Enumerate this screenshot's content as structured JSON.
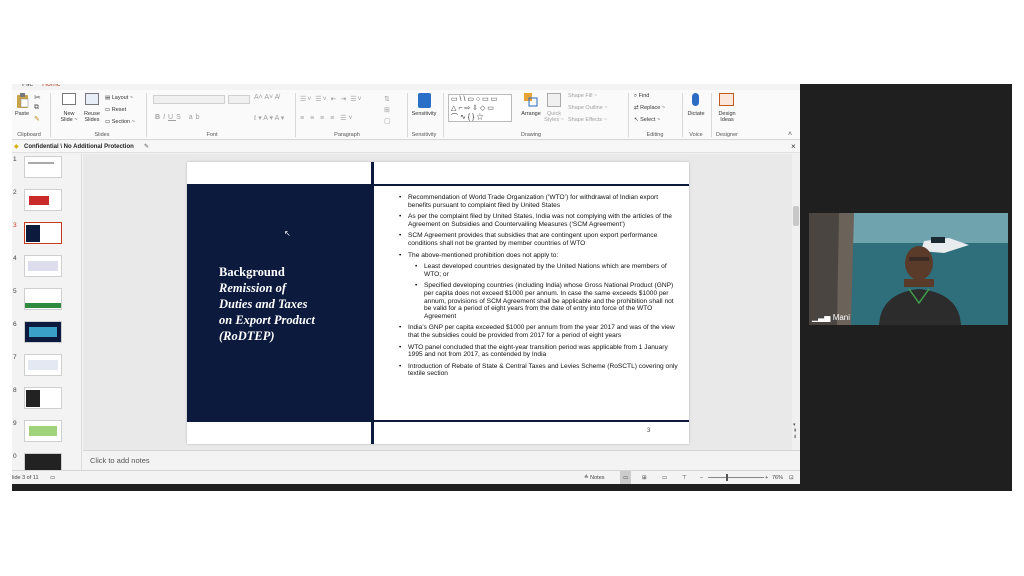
{
  "ribbon": {
    "clipboard": {
      "paste": "Paste",
      "group": "Clipboard"
    },
    "slides": {
      "new_slide": "New\nSlide ~",
      "reuse_slides": "Reuse\nSlides",
      "layout": "Layout ~",
      "reset": "Reset",
      "section": "Section ~",
      "group": "Slides"
    },
    "font": {
      "group": "Font"
    },
    "paragraph": {
      "group": "Paragraph"
    },
    "sensitivity": {
      "label": "Sensitivity",
      "group": "Sensitivity"
    },
    "drawing": {
      "arrange": "Arrange",
      "quick_styles": "Quick\nStyles ~",
      "shape_fill": "Shape Fill ~",
      "shape_outline": "Shape Outline ~",
      "shape_effects": "Shape Effects ~",
      "group": "Drawing"
    },
    "editing": {
      "find": "Find",
      "replace": "Replace ~",
      "select": "Select ~",
      "group": "Editing"
    },
    "voice": {
      "dictate": "Dictate",
      "group": "Voice"
    },
    "designer": {
      "design_ideas": "Design\nIdeas",
      "group": "Designer"
    }
  },
  "confidential_bar": {
    "label": "Confidential \\ No Additional Protection",
    "close": "×"
  },
  "thumbnails": {
    "numbers": [
      "1",
      "2",
      "3",
      "4",
      "5",
      "6",
      "7",
      "8",
      "9",
      "0"
    ],
    "selected": 3
  },
  "slide": {
    "title_line1": "Background",
    "title_line2": "Remission of",
    "title_line3": "Duties and Taxes",
    "title_line4": "on Export Product",
    "title_line5": "(RoDTEP)",
    "bullets": [
      "Recommendation of World Trade Organization (‘WTO’) for withdrawal of Indian export benefits pursuant to complaint filed by United States",
      "As per the complaint filed by United States, India was not complying with the articles of the Agreement on Subsidies and Countervailing Measures (‘SCM Agreement’)",
      "SCM Agreement provides that subsidies that are contingent upon export performance conditions shall not be granted by member countries of WTO",
      "The above-mentioned prohibition does not apply to:"
    ],
    "sub_bullets": [
      "Least developed countries designated by the United Nations which are members of WTO; or",
      "Specified developing countries (including India) whose Gross National Product (GNP) per capita does not exceed $1000 per annum. In case the same exceeds $1000 per annum,  provisions of SCM Agreement shall be applicable and the prohibition shall not be valid for a period of eight years from the date of entry into force of the WTO Agreement"
    ],
    "bullets_after": [
      "India’s GNP per capita exceeded $1000 per annum from the year 2017 and was of the view that the subsidies could be provided from 2017 for a period of eight years",
      "WTO panel concluded that the eight-year transition period was applicable from 1 January 1995 and not from 2017, as contended by India",
      "Introduction of Rebate of State & Central Taxes and Levies Scheme (RoSCTL) covering only textile section"
    ],
    "page_number": "3"
  },
  "notes": {
    "placeholder": "Click to add notes"
  },
  "status": {
    "slide_count": "lide 3 of 11",
    "notes": "Notes",
    "zoom": "76%"
  },
  "video": {
    "participant_name": "Mani"
  }
}
